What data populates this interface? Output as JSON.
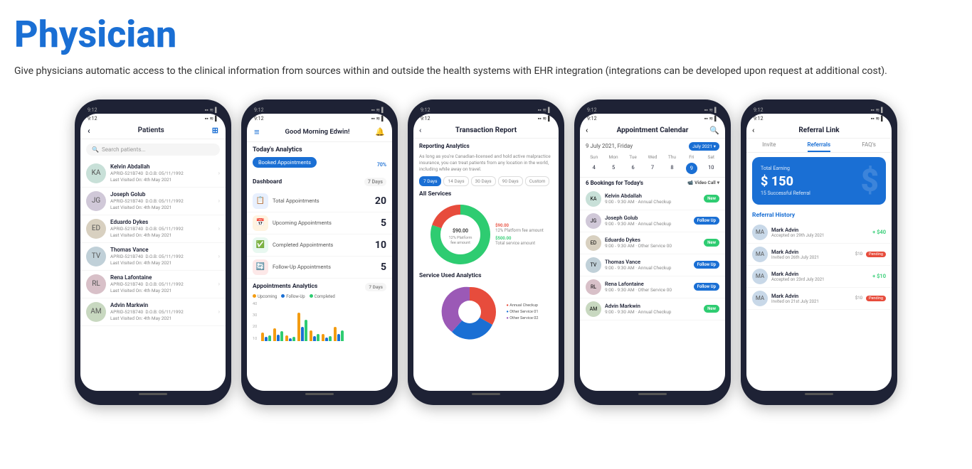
{
  "header": {
    "title": "Physician",
    "description": "Give physicians automatic access to the clinical information from sources within and outside the health systems with EHR integration (integrations can be developed upon request at additional cost)."
  },
  "phones": [
    {
      "id": "phone-patients",
      "screen_title": "Patients",
      "status_time": "9:12",
      "search_placeholder": "Search patients...",
      "patients": [
        {
          "name": "Kelvin Abdallah",
          "aprid": "APRID-521B740",
          "dob": "D.O.B: 05/11/1992",
          "last": "Last Visited On: 4th May 2021"
        },
        {
          "name": "Joseph Golub",
          "aprid": "APRID-521B740",
          "dob": "D.O.B: 05/11/1992",
          "last": "Last Visited On: 4th May 2021"
        },
        {
          "name": "Eduardo Dykes",
          "aprid": "APRID-521B740",
          "dob": "D.O.B: 05/11/1992",
          "last": "Last Visited On: 4th May 2021"
        },
        {
          "name": "Thomas Vance",
          "aprid": "APRID-521B740",
          "dob": "D.O.B: 05/11/1992",
          "last": "Last Visited On: 4th May 2021"
        },
        {
          "name": "Rena Lafontaine",
          "aprid": "APRID-521B740",
          "dob": "D.O.B: 05/11/1992",
          "last": "Last Visited On: 4th May 2021"
        },
        {
          "name": "Advin Markwin",
          "aprid": "APRID-521B740",
          "dob": "D.O.B: 05/11/1992",
          "last": "Last Visited On: 4th May 2021"
        }
      ]
    },
    {
      "id": "phone-dashboard",
      "status_time": "9:12",
      "greeting": "Good Morning Edwin!",
      "today_analytics": "Today's Analytics",
      "booked_tab": "Booked Appointments",
      "booked_pct": "70%",
      "dashboard": "Dashboard",
      "days": "7 Days",
      "metrics": [
        {
          "icon": "📋",
          "label": "Total Appointments",
          "value": "20"
        },
        {
          "icon": "📅",
          "label": "Upcoming Appointments",
          "value": "5"
        },
        {
          "icon": "✅",
          "label": "Completed Appointments",
          "value": "10"
        },
        {
          "icon": "🔄",
          "label": "Follow-Up Appointments",
          "value": "5"
        }
      ],
      "appointments_analytics": "Appointments Analytics",
      "analytics_days": "7 Days",
      "legend": [
        "Upcoming",
        "Follow-Up",
        "Completed"
      ],
      "legend_colors": [
        "#f39c12",
        "#1a6fd4",
        "#2ecc71"
      ]
    },
    {
      "id": "phone-transaction",
      "status_time": "9:12",
      "screen_title": "Transaction Report",
      "reporting_analytics": "Reporting Analytics",
      "description": "As long as you're Canadian-licensed and hold active malpractice insurance, you can treat patients from any location in the world, including while away on travel.",
      "filters": [
        "7 Days",
        "14 Days",
        "30 Days",
        "90 Days",
        "Custom"
      ],
      "active_filter": 0,
      "all_services": "All Services",
      "donut_labels": [
        "$90.00\n12% Platform fee amount",
        "$500.00\nTotal service amount"
      ],
      "service_analytics": "Service Used Analytics",
      "pie_labels": [
        "Annual Checkup",
        "Other Service 01",
        "Other Service 02"
      ],
      "pie_colors": [
        "#e74c3c",
        "#1a6fd4",
        "#9b59b6"
      ]
    },
    {
      "id": "phone-calendar",
      "status_time": "9:12",
      "screen_title": "Appointment Calendar",
      "date_label": "9 July 2021, Friday",
      "month_btn": "July 2021",
      "day_headers": [
        "Sun",
        "Mon",
        "Tue",
        "Wed",
        "Thu",
        "Fri",
        "Sat"
      ],
      "days": [
        "4",
        "5",
        "6",
        "7",
        "8",
        "9",
        "10"
      ],
      "today_day": "9",
      "bookings_title": "6 Bookings for Today's",
      "video_call": "Video Call",
      "bookings": [
        {
          "name": "Kelvin Abdallah",
          "time": "9:00 - 9:30 AM · Annual Checkup",
          "badge": "New",
          "badge_type": "new"
        },
        {
          "name": "Joseph Golub",
          "time": "9:00 - 9:30 AM · Annual Checkup",
          "badge": "Follow Up",
          "badge_type": "followup"
        },
        {
          "name": "Eduardo Dykes",
          "time": "9:00 - 9:30 AM · Other Service 00",
          "badge": "New",
          "badge_type": "new"
        },
        {
          "name": "Thomas Vance",
          "time": "9:00 - 9:30 AM · Annual Checkup",
          "badge": "Follow Up",
          "badge_type": "followup"
        },
        {
          "name": "Rena Lafontaine",
          "time": "9:00 - 9:30 AM · Other Service 00",
          "badge": "Follow Up",
          "badge_type": "followup"
        },
        {
          "name": "Advin Markwin",
          "time": "9:00 - 9:30 AM · Annual Checkup",
          "badge": "New",
          "badge_type": "new"
        }
      ]
    },
    {
      "id": "phone-referral",
      "status_time": "9:12",
      "screen_title": "Referral Link",
      "tabs": [
        "Invite",
        "Referrals",
        "FAQ's"
      ],
      "active_tab": 1,
      "banner_amount": "$ 150",
      "banner_subtitle": "15 Successful Referral",
      "referral_history": "Referral History",
      "referrals": [
        {
          "name": "Mark Advin",
          "date": "Accepted on 29th July 2021",
          "amount": "+ $40",
          "pending": false
        },
        {
          "name": "Mark Advin",
          "date": "Invited on 26th July 2021",
          "amount": "$10",
          "pending": true,
          "pending_label": "Pending"
        },
        {
          "name": "Mark Advin",
          "date": "Accepted on 23rd July 2021",
          "amount": "+ $10",
          "pending": false
        },
        {
          "name": "Mark Advin",
          "date": "Invited on 21st July 2021",
          "amount": "$10",
          "pending": true,
          "pending_label": "Pending"
        }
      ]
    }
  ],
  "icons": {
    "back": "‹",
    "search": "🔍",
    "menu": "≡",
    "bell": "🔔",
    "chevron_right": "›",
    "chevron_down": "▾",
    "bars": "|||",
    "grid": "⊞",
    "dollar": "$"
  }
}
